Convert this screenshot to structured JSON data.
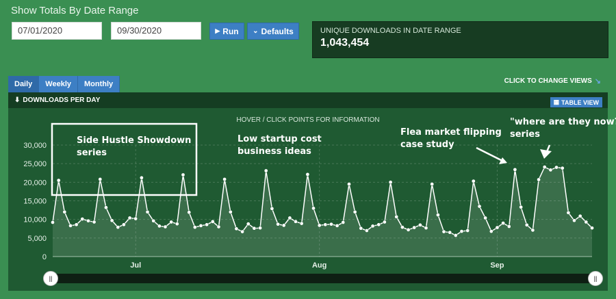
{
  "header": {
    "title": "Show Totals By Date Range"
  },
  "filters": {
    "start_date": "07/01/2020",
    "end_date": "09/30/2020",
    "run_label": "Run",
    "defaults_label": "Defaults"
  },
  "stats": {
    "label": "UNIQUE DOWNLOADS IN DATE RANGE",
    "value": "1,043,454"
  },
  "tabs": [
    {
      "label": "Daily"
    },
    {
      "label": "Weekly"
    },
    {
      "label": "Monthly"
    }
  ],
  "views": {
    "change_label": "CLICK TO CHANGE VIEWS"
  },
  "panel": {
    "title": "DOWNLOADS PER DAY",
    "table_view_label": "TABLE VIEW",
    "hover_note": "HOVER / CLICK POINTS FOR INFORMATION"
  },
  "annotations": [
    {
      "text": "Side Hustle Showdown series"
    },
    {
      "text": "Low startup cost business ideas"
    },
    {
      "text": "Flea market flipping case study"
    },
    {
      "text": "\"where are they now?\" series"
    }
  ],
  "colors": {
    "background": "#3a8f52",
    "panel": "#1f5a32",
    "button": "#3d7fc4",
    "line": "#ffffff"
  },
  "chart_data": {
    "type": "area",
    "ylim": [
      0,
      30000
    ],
    "y_ticks": [
      "0",
      "5,000",
      "10,000",
      "15,000",
      "20,000",
      "25,000",
      "30,000"
    ],
    "month_labels": [
      "Jul",
      "Aug",
      "Sep"
    ],
    "month_label_days": [
      14,
      45,
      75
    ],
    "values": [
      9200,
      20500,
      12000,
      8300,
      8600,
      10100,
      9600,
      9300,
      20800,
      13200,
      9700,
      7900,
      8600,
      10400,
      10200,
      21200,
      12000,
      9600,
      8200,
      8000,
      9300,
      8800,
      22000,
      11900,
      7900,
      8300,
      8600,
      9400,
      8000,
      20800,
      12000,
      7500,
      6700,
      8800,
      7600,
      7700,
      23100,
      12900,
      8700,
      8400,
      10400,
      9400,
      8900,
      22100,
      13000,
      8400,
      8600,
      8700,
      8300,
      9200,
      19500,
      12000,
      7600,
      7000,
      8200,
      8600,
      9300,
      20000,
      10700,
      7900,
      7200,
      7800,
      8500,
      7700,
      19500,
      11200,
      6700,
      6500,
      5700,
      6800,
      7000,
      20300,
      13500,
      10400,
      6800,
      7800,
      9000,
      8100,
      23400,
      13300,
      8500,
      7100,
      20700,
      24100,
      23300,
      24000,
      23800,
      11800,
      9700,
      10900,
      9300,
      7700
    ]
  }
}
